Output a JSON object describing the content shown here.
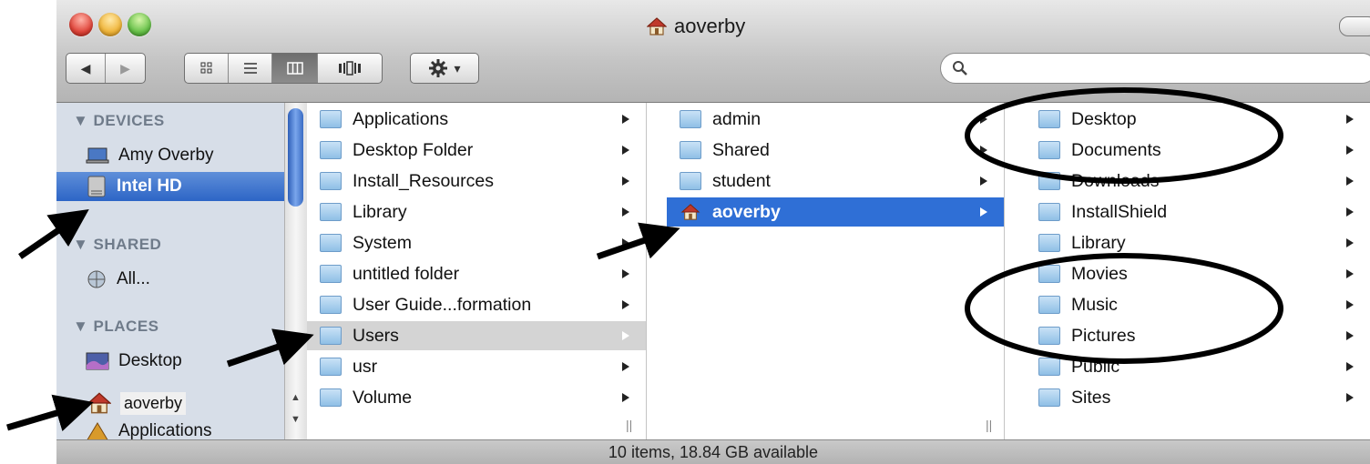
{
  "window": {
    "title": "aoverby"
  },
  "toolbar": {
    "back": "◀",
    "forward": "▶",
    "views": [
      "icon-view",
      "list-view",
      "column-view",
      "coverflow-view"
    ],
    "action_label": "▾",
    "search_placeholder": ""
  },
  "sidebar": {
    "devices_header": "▼ DEVICES",
    "devices": [
      {
        "label": "Amy Overby",
        "icon": "laptop-icon"
      },
      {
        "label": "Intel HD",
        "icon": "hard-drive-icon"
      }
    ],
    "shared_header": "▼ SHARED",
    "shared": [
      {
        "label": "All...",
        "icon": "network-icon"
      }
    ],
    "places_header": "▼ PLACES",
    "places": [
      {
        "label": "Desktop",
        "icon": "desktop-icon"
      },
      {
        "label": "aoverby",
        "icon": "home-icon"
      },
      {
        "label": "Applications",
        "icon": "applications-icon"
      }
    ]
  },
  "columns": {
    "col1": [
      {
        "label": "Applications",
        "arrow": true
      },
      {
        "label": "Desktop Folder",
        "arrow": true
      },
      {
        "label": "Install_Resources",
        "arrow": true
      },
      {
        "label": "Library",
        "arrow": true
      },
      {
        "label": "System",
        "arrow": true
      },
      {
        "label": "untitled folder",
        "arrow": true
      },
      {
        "label": "User Guide...formation",
        "arrow": true
      },
      {
        "label": "Users",
        "arrow": true
      },
      {
        "label": "usr",
        "arrow": true
      },
      {
        "label": "Volume",
        "arrow": true
      }
    ],
    "col2": [
      {
        "label": "admin",
        "arrow": true
      },
      {
        "label": "Shared",
        "arrow": true
      },
      {
        "label": "student",
        "arrow": true
      },
      {
        "label": "aoverby",
        "arrow": true
      }
    ],
    "col3": [
      {
        "label": "Desktop",
        "arrow": true
      },
      {
        "label": "Documents",
        "arrow": true
      },
      {
        "label": "Downloads",
        "arrow": true
      },
      {
        "label": "InstallShield",
        "arrow": true
      },
      {
        "label": "Library",
        "arrow": true
      },
      {
        "label": "Movies",
        "arrow": true
      },
      {
        "label": "Music",
        "arrow": true
      },
      {
        "label": "Pictures",
        "arrow": true
      },
      {
        "label": "Public",
        "arrow": true
      },
      {
        "label": "Sites",
        "arrow": true
      }
    ]
  },
  "status": {
    "text": "10 items, 18.84 GB available"
  },
  "colors": {
    "selection": "#2f6fd6",
    "sidebar": "#d7dee8"
  }
}
